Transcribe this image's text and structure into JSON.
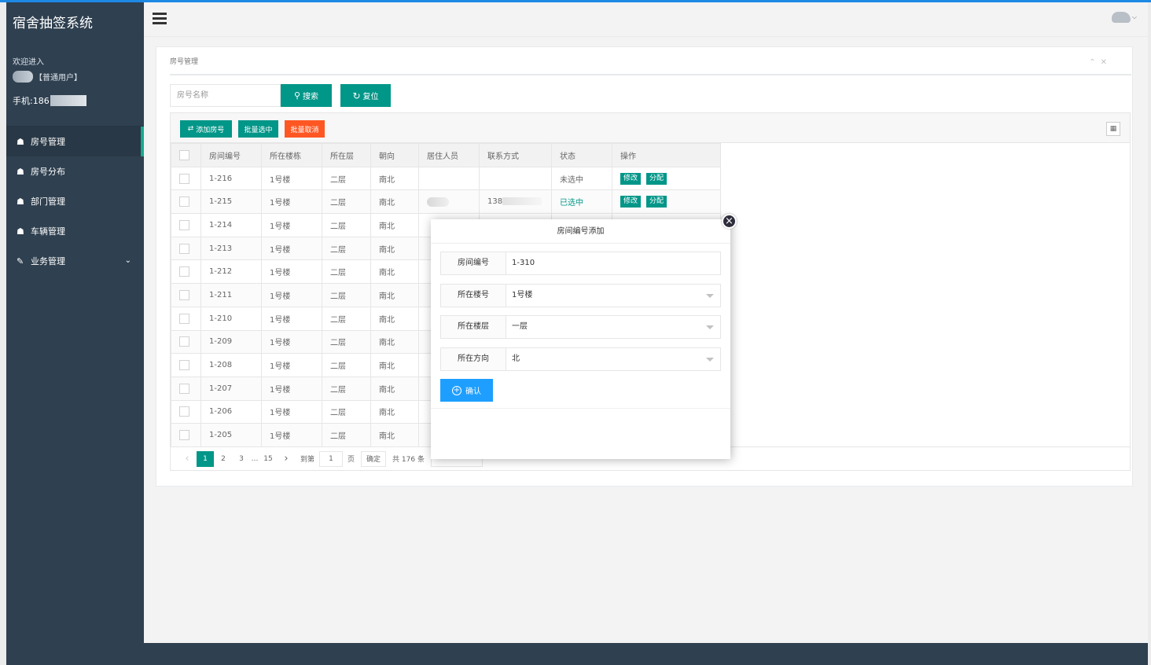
{
  "app": {
    "title": "宿舍抽签系统"
  },
  "sidebar": {
    "welcome": "欢迎进入",
    "role": "【普通用户】",
    "phone_prefix": "手机:186",
    "items": [
      {
        "label": "房号管理",
        "icon": "home-icon",
        "active": true
      },
      {
        "label": "房号分布",
        "icon": "home-icon"
      },
      {
        "label": "部门管理",
        "icon": "home-icon"
      },
      {
        "label": "车辆管理",
        "icon": "home-icon"
      },
      {
        "label": "业务管理",
        "icon": "edit-icon",
        "has_children": true
      }
    ]
  },
  "panel": {
    "title": "房号管理"
  },
  "search": {
    "placeholder": "房号名称",
    "search_label": "搜索",
    "reset_label": "复位"
  },
  "toolbar": {
    "add_label": "添加房号",
    "batch_select_label": "批量选中",
    "batch_cancel_label": "批量取消"
  },
  "table": {
    "columns": [
      "房间编号",
      "所在楼栋",
      "所在层",
      "朝向",
      "居住人员",
      "联系方式",
      "状态",
      "操作"
    ],
    "rows": [
      {
        "room": "1-216",
        "building": "1号楼",
        "floor": "二层",
        "direction": "南北",
        "resident": "",
        "phone": "",
        "status": "未选中"
      },
      {
        "room": "1-215",
        "building": "1号楼",
        "floor": "二层",
        "direction": "南北",
        "resident": "",
        "phone": "138",
        "status": "已选中"
      },
      {
        "room": "1-214",
        "building": "1号楼",
        "floor": "二层",
        "direction": "南北"
      },
      {
        "room": "1-213",
        "building": "1号楼",
        "floor": "二层",
        "direction": "南北"
      },
      {
        "room": "1-212",
        "building": "1号楼",
        "floor": "二层",
        "direction": "南北"
      },
      {
        "room": "1-211",
        "building": "1号楼",
        "floor": "二层",
        "direction": "南北"
      },
      {
        "room": "1-210",
        "building": "1号楼",
        "floor": "二层",
        "direction": "南北"
      },
      {
        "room": "1-209",
        "building": "1号楼",
        "floor": "二层",
        "direction": "南北"
      },
      {
        "room": "1-208",
        "building": "1号楼",
        "floor": "二层",
        "direction": "南北"
      },
      {
        "room": "1-207",
        "building": "1号楼",
        "floor": "二层",
        "direction": "南北"
      },
      {
        "room": "1-206",
        "building": "1号楼",
        "floor": "二层",
        "direction": "南北"
      },
      {
        "room": "1-205",
        "building": "1号楼",
        "floor": "二层",
        "direction": "南北"
      }
    ],
    "action_edit": "修改",
    "action_assign": "分配"
  },
  "pager": {
    "prev": "‹",
    "pages": [
      "1",
      "2",
      "3",
      "…",
      "15"
    ],
    "current": "1",
    "next": "›",
    "goto_label": "到第",
    "goto_value": "1",
    "page_unit": "页",
    "confirm": "确定",
    "total": "共 176 条"
  },
  "modal": {
    "title": "房间编号添加",
    "fields": [
      {
        "label": "房间编号",
        "value": "1-310",
        "type": "text"
      },
      {
        "label": "所在楼号",
        "value": "1号楼",
        "type": "select"
      },
      {
        "label": "所在楼层",
        "value": "一层",
        "type": "select"
      },
      {
        "label": "所在方向",
        "value": "北",
        "type": "select"
      }
    ],
    "confirm_label": "确认"
  },
  "colors": {
    "sidebar": "#2f4050",
    "primary": "#009688",
    "danger": "#ff5722",
    "blue": "#1e9fff"
  }
}
